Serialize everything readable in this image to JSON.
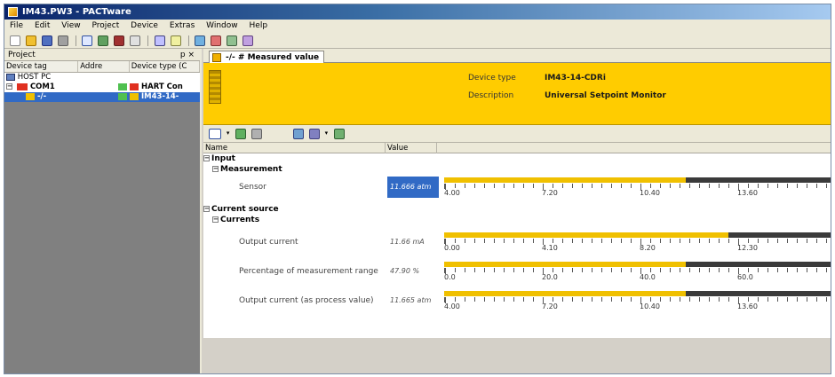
{
  "window": {
    "title": "IM43.PW3 - PACTware"
  },
  "menu": [
    "File",
    "Edit",
    "View",
    "Project",
    "Device",
    "Extras",
    "Window",
    "Help"
  ],
  "project_panel": {
    "title": "Project",
    "pin": "p ×",
    "columns": [
      "Device tag",
      "Addre",
      "Device type (C"
    ],
    "tree": [
      {
        "tag": "HOST PC",
        "type": "",
        "selected": false,
        "indent": 0
      },
      {
        "tag": "COM1",
        "type": "HART Con",
        "selected": false,
        "indent": 1
      },
      {
        "tag": "-/-",
        "type": "IM43-14-",
        "selected": true,
        "indent": 2
      }
    ]
  },
  "document": {
    "tab_label": "-/- # Measured value",
    "header": {
      "device_type_label": "Device type",
      "device_type_value": "IM43-14-CDRi",
      "description_label": "Description",
      "description_value": "Universal Setpoint Monitor"
    },
    "grid_columns": [
      "Name",
      "Value"
    ],
    "groups": [
      {
        "label": "Input",
        "subgroup": "Measurement",
        "rows": [
          {
            "name": "Sensor",
            "value": "11.666 atm",
            "selected": true,
            "fill_fraction": 0.625,
            "scale": [
              "4.00",
              "7.20",
              "10.40",
              "13.60"
            ]
          }
        ]
      },
      {
        "label": "Current source",
        "subgroup": "Currents",
        "rows": [
          {
            "name": "Output current",
            "value": "11.66 mA",
            "selected": false,
            "fill_fraction": 0.735,
            "scale": [
              "0.00",
              "4.10",
              "8.20",
              "12.30"
            ]
          },
          {
            "name": "Percentage of measurement range",
            "value": "47.90 %",
            "selected": false,
            "fill_fraction": 0.625,
            "scale": [
              "0.0",
              "20.0",
              "40.0",
              "60.0"
            ]
          },
          {
            "name": "Output current (as process value)",
            "value": "11.665 atm",
            "selected": false,
            "fill_fraction": 0.625,
            "scale": [
              "4.00",
              "7.20",
              "10.40",
              "13.60"
            ]
          }
        ]
      }
    ]
  },
  "colors": {
    "header_bg": "#ffcc00",
    "gauge_fill": "#f0c000",
    "gauge_track": "#3a3a3a",
    "selection": "#316ac5"
  }
}
